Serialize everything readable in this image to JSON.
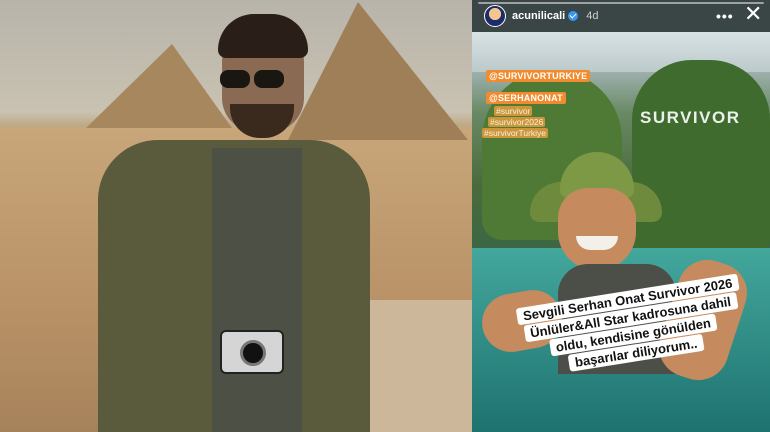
{
  "story": {
    "username": "acunilicali",
    "time_ago": "4d",
    "more_label": "•••",
    "close_label": "✕",
    "brand_overlay": "SURVIVOR",
    "mentions": [
      "@SURVIVORTURKIYE",
      "@SERHANONAT",
      "#survivor",
      "#survivor2026",
      "#survivorTurkiye"
    ],
    "caption_lines": [
      "Sevgili Serhan Onat Survivor 2026",
      "Ünlüler&All Star kadrosuna dahil",
      "oldu, kendisine gönülden",
      "başarılar diliyorum.."
    ]
  },
  "colors": {
    "mention_tag": "#f08c2f",
    "verified_badge": "#3897f0",
    "caption_bg": "#ffffff"
  }
}
